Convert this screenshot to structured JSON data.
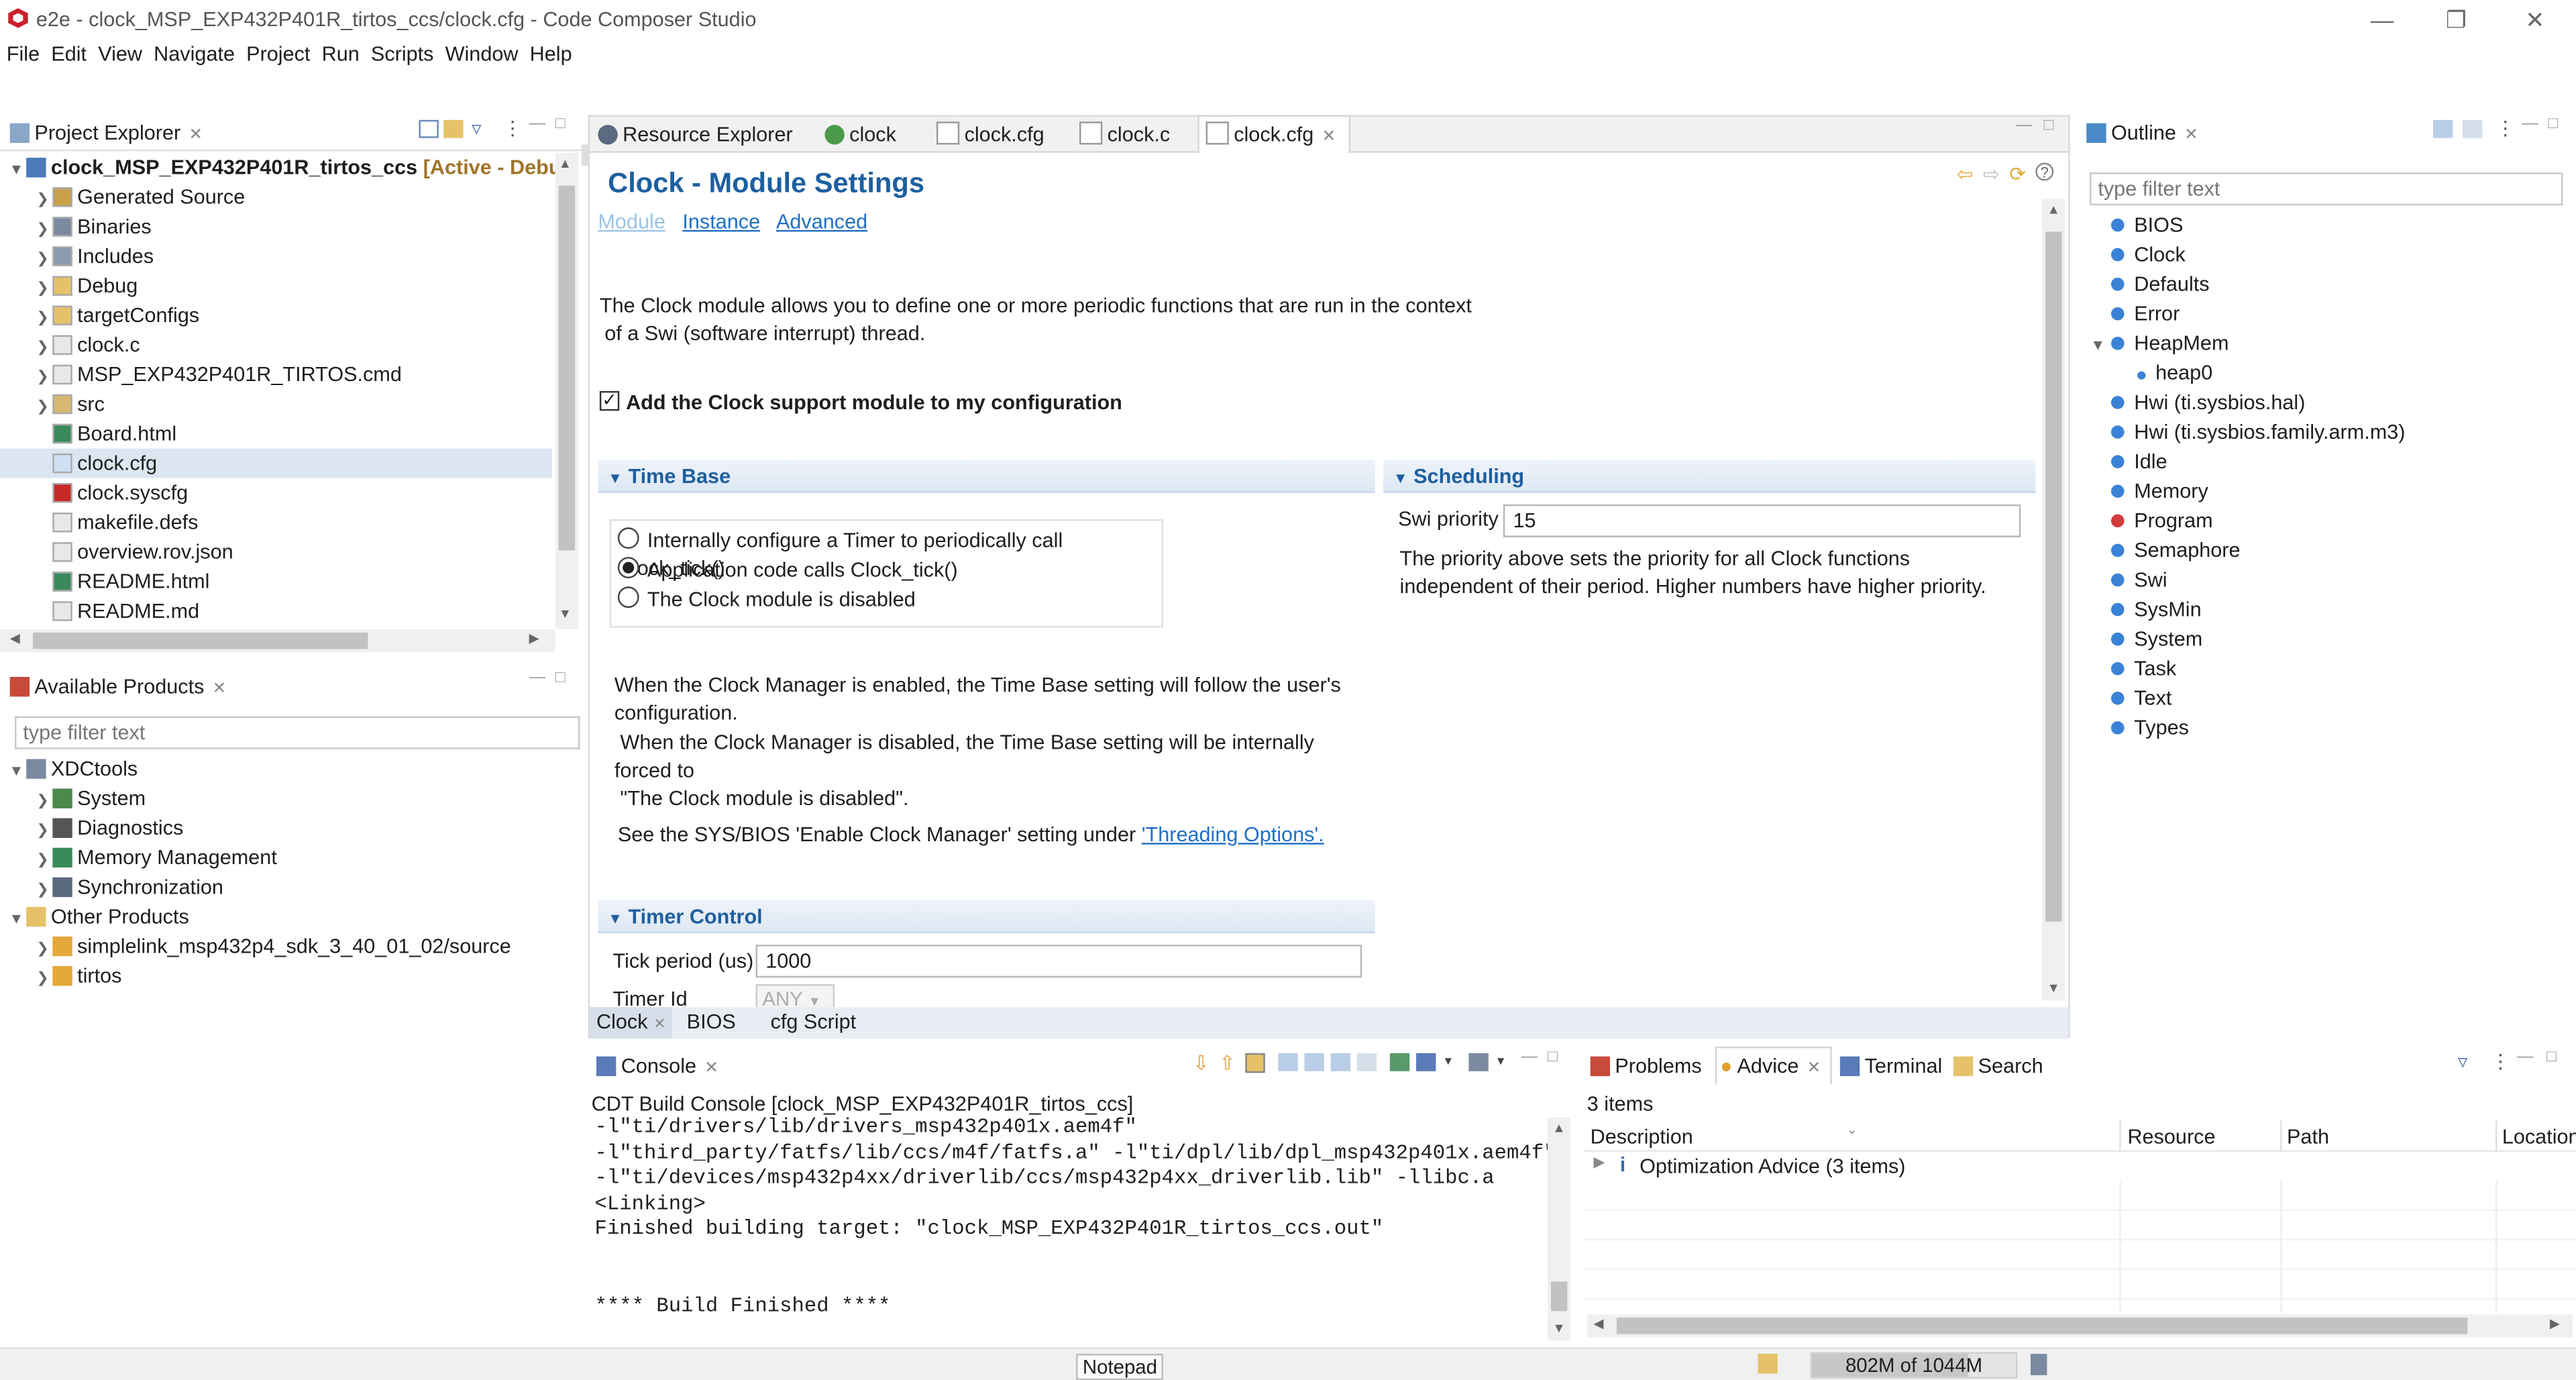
{
  "window": {
    "title": "e2e - clock_MSP_EXP432P401R_tirtos_ccs/clock.cfg - Code Composer Studio",
    "menu": [
      "File",
      "Edit",
      "View",
      "Navigate",
      "Project",
      "Run",
      "Scripts",
      "Window",
      "Help"
    ]
  },
  "project_explorer": {
    "tab_label": "Project Explorer",
    "project_name": "clock_MSP_EXP432P401R_tirtos_ccs",
    "project_status": "[Active - Debug",
    "items": [
      {
        "label": "Generated Source",
        "icon": "folder-gen-icon",
        "expandable": true
      },
      {
        "label": "Binaries",
        "icon": "binaries-icon",
        "expandable": true
      },
      {
        "label": "Includes",
        "icon": "includes-icon",
        "expandable": true
      },
      {
        "label": "Debug",
        "icon": "folder-icon",
        "expandable": true
      },
      {
        "label": "targetConfigs",
        "icon": "folder-icon",
        "expandable": true
      },
      {
        "label": "clock.c",
        "icon": "c-file-icon",
        "expandable": true
      },
      {
        "label": "MSP_EXP432P401R_TIRTOS.cmd",
        "icon": "file-icon",
        "expandable": true
      },
      {
        "label": "src",
        "icon": "folder-link-icon",
        "expandable": true
      },
      {
        "label": "Board.html",
        "icon": "html-file-icon",
        "expandable": false
      },
      {
        "label": "clock.cfg",
        "icon": "cfg-file-icon",
        "expandable": false
      },
      {
        "label": "clock.syscfg",
        "icon": "syscfg-file-icon",
        "expandable": false
      },
      {
        "label": "makefile.defs",
        "icon": "file-icon",
        "expandable": false
      },
      {
        "label": "overview.rov.json",
        "icon": "file-icon",
        "expandable": false
      },
      {
        "label": "README.html",
        "icon": "html-file-icon",
        "expandable": false
      },
      {
        "label": "README.md",
        "icon": "file-icon",
        "expandable": false
      }
    ]
  },
  "available_products": {
    "tab_label": "Available Products",
    "filter_placeholder": "type filter text",
    "xdctools": "XDCtools",
    "xdc_children": [
      "System",
      "Diagnostics",
      "Memory Management",
      "Synchronization"
    ],
    "other_products": "Other Products",
    "other_children": [
      "simplelink_msp432p4_sdk_3_40_01_02/source",
      "tirtos"
    ]
  },
  "editor": {
    "tabs": [
      "Resource Explorer",
      "clock",
      "clock.cfg",
      "clock.c",
      "clock.cfg"
    ],
    "page_title": "Clock - Module Settings",
    "subnav": [
      "Module",
      "Instance",
      "Advanced"
    ],
    "description_line1": "The Clock module allows you to define one or more periodic functions that are run in the context",
    "description_line2": "of a Swi (software interrupt) thread.",
    "enable_checkbox_label": "Add the Clock support module to my configuration",
    "time_base": {
      "header": "Time Base",
      "options": [
        "Internally configure a Timer to periodically call Clock_tick()",
        "Application code calls Clock_tick()",
        "The Clock module is disabled"
      ],
      "selected_option": "Application code calls Clock_tick()",
      "note_lines": [
        "When the Clock Manager is enabled, the Time Base setting will follow the user's",
        "configuration.",
        " When the Clock Manager is disabled, the Time Base setting will be internally",
        "forced to",
        " \"The Clock module is disabled\"."
      ],
      "see_text": "See the SYS/BIOS 'Enable Clock Manager' setting under",
      "see_link": "'Threading Options'."
    },
    "scheduling": {
      "header": "Scheduling",
      "swi_label": "Swi priority",
      "swi_value": "15",
      "help_line1": "The priority above sets the priority for all Clock functions",
      "help_line2": "independent of their period. Higher numbers have higher priority."
    },
    "timer_control": {
      "header": "Timer Control",
      "tick_label": "Tick period (us)",
      "tick_value": "1000",
      "timer_id_label": "Timer Id",
      "timer_id_value": "ANY"
    },
    "bottom_tabs": [
      "Clock",
      "BIOS",
      "cfg Script"
    ]
  },
  "outline": {
    "tab_label": "Outline",
    "filter_placeholder": "type filter text",
    "items": [
      {
        "label": "BIOS",
        "color": "#3b82d6"
      },
      {
        "label": "Clock",
        "color": "#3b82d6"
      },
      {
        "label": "Defaults",
        "color": "#3b82d6"
      },
      {
        "label": "Error",
        "color": "#3b82d6"
      },
      {
        "label": "HeapMem",
        "color": "#3b82d6",
        "expanded": true
      },
      {
        "label": "heap0",
        "color": "#3b82d6",
        "child": true
      },
      {
        "label": "Hwi (ti.sysbios.hal)",
        "color": "#3b82d6"
      },
      {
        "label": "Hwi (ti.sysbios.family.arm.m3)",
        "color": "#3b82d6"
      },
      {
        "label": "Idle",
        "color": "#3b82d6"
      },
      {
        "label": "Memory",
        "color": "#3b82d6"
      },
      {
        "label": "Program",
        "color": "#d43b3b"
      },
      {
        "label": "Semaphore",
        "color": "#3b82d6"
      },
      {
        "label": "Swi",
        "color": "#3b82d6"
      },
      {
        "label": "SysMin",
        "color": "#3b82d6"
      },
      {
        "label": "System",
        "color": "#3b82d6"
      },
      {
        "label": "Task",
        "color": "#3b82d6"
      },
      {
        "label": "Text",
        "color": "#3b82d6"
      },
      {
        "label": "Types",
        "color": "#3b82d6"
      }
    ]
  },
  "console": {
    "tab_label": "Console",
    "header": "CDT Build Console [clock_MSP_EXP432P401R_tirtos_ccs]",
    "lines": [
      "-l\"ti/drivers/lib/drivers_msp432p401x.aem4f\"",
      "-l\"third_party/fatfs/lib/ccs/m4f/fatfs.a\" -l\"ti/dpl/lib/dpl_msp432p401x.aem4f\"",
      "-l\"ti/devices/msp432p4xx/driverlib/ccs/msp432p4xx_driverlib.lib\" -llibc.a",
      "<Linking>",
      "Finished building target: \"clock_MSP_EXP432P401R_tirtos_ccs.out\"",
      "",
      "",
      "**** Build Finished ****"
    ]
  },
  "problems": {
    "tabs": [
      "Problems",
      "Advice",
      "Terminal",
      "Search"
    ],
    "count": "3 items",
    "columns": [
      "Description",
      "Resource",
      "Path",
      "Location"
    ],
    "rows": [
      "Optimization Advice (3 items)"
    ]
  },
  "statusbar": {
    "notepad": "Notepad",
    "heap": "802M of 1044M",
    "heap_fraction": 0.768
  }
}
